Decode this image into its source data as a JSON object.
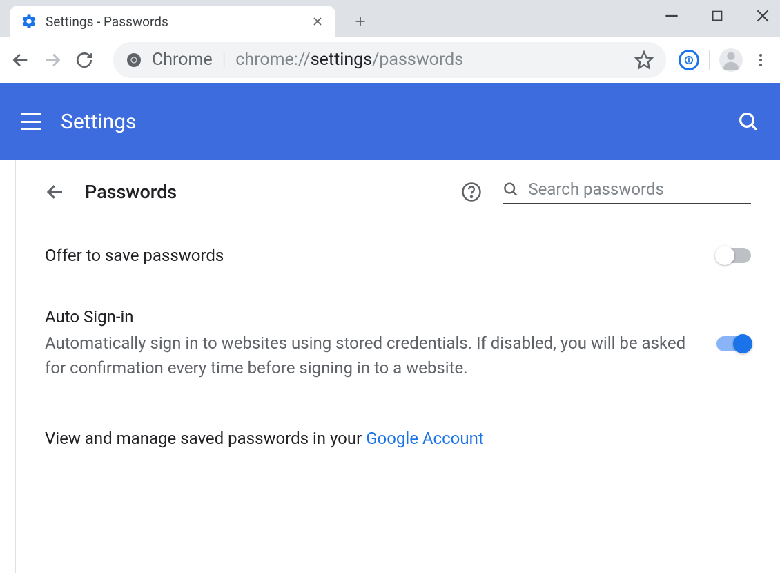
{
  "window": {
    "tab_title": "Settings - Passwords"
  },
  "omnibox": {
    "label": "Chrome",
    "url_scheme": "chrome://",
    "url_path": "settings",
    "url_sub": "/passwords"
  },
  "header": {
    "title": "Settings"
  },
  "page": {
    "heading": "Passwords",
    "search_placeholder": "Search passwords"
  },
  "settings": {
    "offer_save": {
      "label": "Offer to save passwords",
      "enabled": false
    },
    "auto_signin": {
      "label": "Auto Sign-in",
      "description": "Automatically sign in to websites using stored credentials. If disabled, you will be asked for confirmation every time before signing in to a website.",
      "enabled": true
    },
    "account_link": {
      "prefix": "View and manage saved passwords in your ",
      "link_text": "Google Account"
    }
  }
}
